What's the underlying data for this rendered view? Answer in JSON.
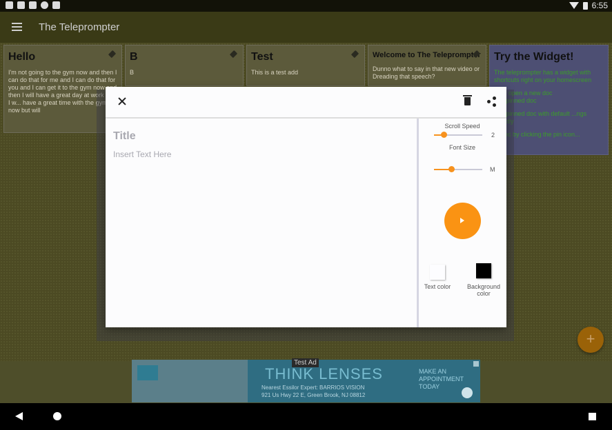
{
  "status_bar": {
    "time": "6:55"
  },
  "app_bar": {
    "title": "The Teleprompter"
  },
  "cards": [
    {
      "title": "Hello",
      "body": "I'm not going to the gym now and then I can do that for me and I can do that for you and I can get it to the gym now and then I will have a great day at work and I w... have a great time with the gym now but will"
    },
    {
      "title": "B",
      "body": "B"
    },
    {
      "title": "Test",
      "body": "This is a test add"
    },
    {
      "title": "Welcome to The Teleprompter",
      "body": "Dunno what to say in that new video or Dreading that speech?"
    },
    {
      "title": "Try the Widget!",
      "body": "The teleprompter has a widget with shortcuts right on your homescreen",
      "body2": "...kly open a new doc",
      "body3": "... a pinned doc",
      "body4": "... a pinned doc with default ...ngs directly",
      "body5": "... doc by clicking the pin icon..."
    }
  ],
  "fab": {
    "label": "+"
  },
  "ad": {
    "label": "Test Ad",
    "headline": "THINK LENSES",
    "expert": "Nearest Essilor Expert: BARRIOS VISION",
    "address": "921 Us Hwy 22 E, Green Brook, NJ 08812",
    "cta": "MAKE AN APPOINTMENT TODAY"
  },
  "dialog": {
    "title_placeholder": "Title",
    "body_placeholder": "Insert Text Here",
    "scroll_speed_label": "Scroll Speed",
    "scroll_speed_value": "2",
    "scroll_speed_fraction": 0.2,
    "font_size_label": "Font Size",
    "font_size_value": "M",
    "font_size_fraction": 0.35,
    "text_color_label": "Text color",
    "background_color_label": "Background color",
    "text_color": "#fdfdff",
    "background_color": "#000000",
    "accent_color": "#fa9313"
  }
}
